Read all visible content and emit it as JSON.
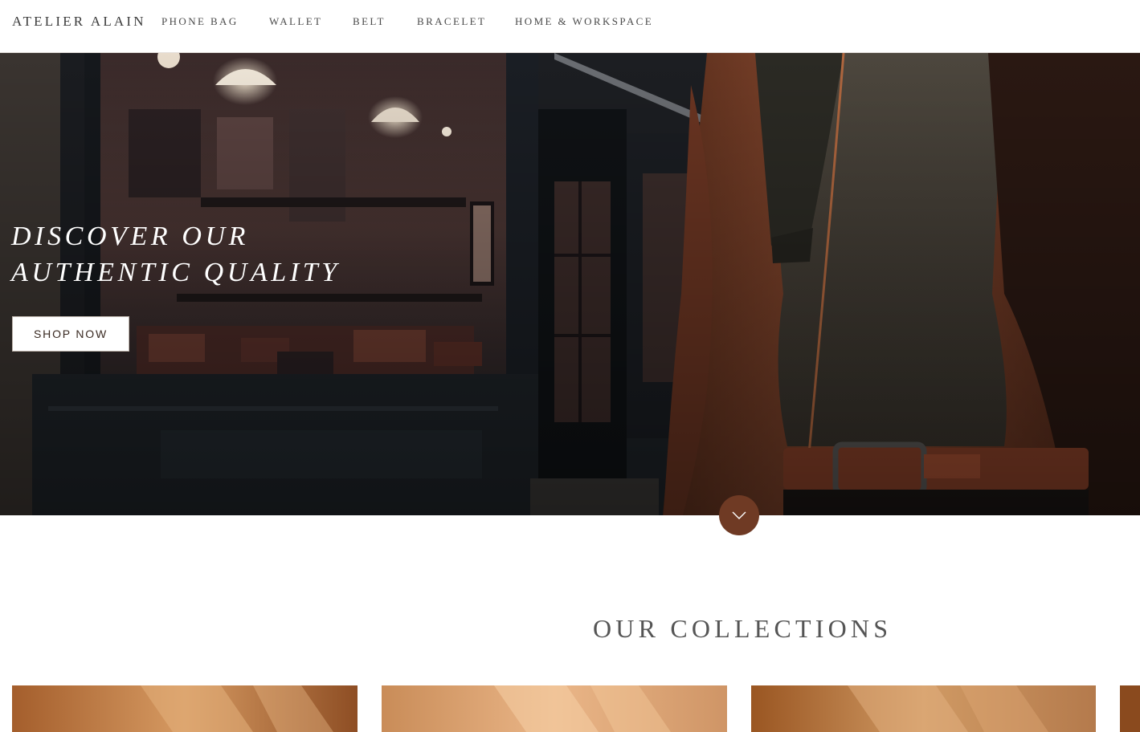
{
  "header": {
    "logo": "ATELIER ALAIN",
    "nav": [
      {
        "label": "PHONE BAG"
      },
      {
        "label": "WALLET"
      },
      {
        "label": "BELT"
      },
      {
        "label": "BRACELET"
      },
      {
        "label": "HOME & WORKSPACE"
      }
    ]
  },
  "hero": {
    "title_line1": "DISCOVER OUR",
    "title_line2": "AUTHENTIC QUALITY",
    "cta_label": "SHOP NOW"
  },
  "scroll_button": {
    "icon": "chevron-down-icon"
  },
  "collections": {
    "title": "OUR COLLECTIONS",
    "items": [
      {
        "image": "leather-collection-image"
      },
      {
        "image": "leather-collection-image"
      },
      {
        "image": "leather-collection-image"
      },
      {
        "image": "leather-collection-image"
      }
    ]
  },
  "colors": {
    "accent": "#6f3a24",
    "text": "#4a4a4a",
    "background": "#ffffff"
  }
}
